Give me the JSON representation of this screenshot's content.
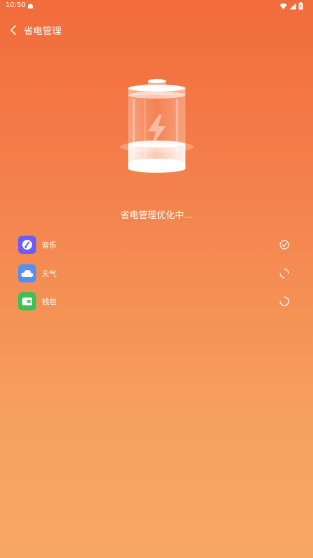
{
  "status_bar": {
    "time": "10:50",
    "icons": [
      "android-icon",
      "wifi-icon",
      "signal-icon",
      "battery-charging-icon"
    ]
  },
  "header": {
    "back_icon": "chevron-left-icon",
    "title": "省电管理"
  },
  "hero": {
    "illustration": "battery-charging-icon",
    "status_text": "省电管理优化中..."
  },
  "apps": [
    {
      "name": "音乐",
      "icon": "music-icon",
      "color": "#6A5CF6",
      "state": "done",
      "state_icon": "check-circle-icon"
    },
    {
      "name": "天气",
      "icon": "cloud-icon",
      "color": "#5B8DEF",
      "state": "loading",
      "state_icon": "spinner-icon"
    },
    {
      "name": "钱包",
      "icon": "wallet-icon",
      "color": "#3CC254",
      "state": "loading",
      "state_icon": "spinner-icon"
    }
  ],
  "colors": {
    "background_top": "#F26B3B",
    "background_bottom": "#F8A862"
  }
}
